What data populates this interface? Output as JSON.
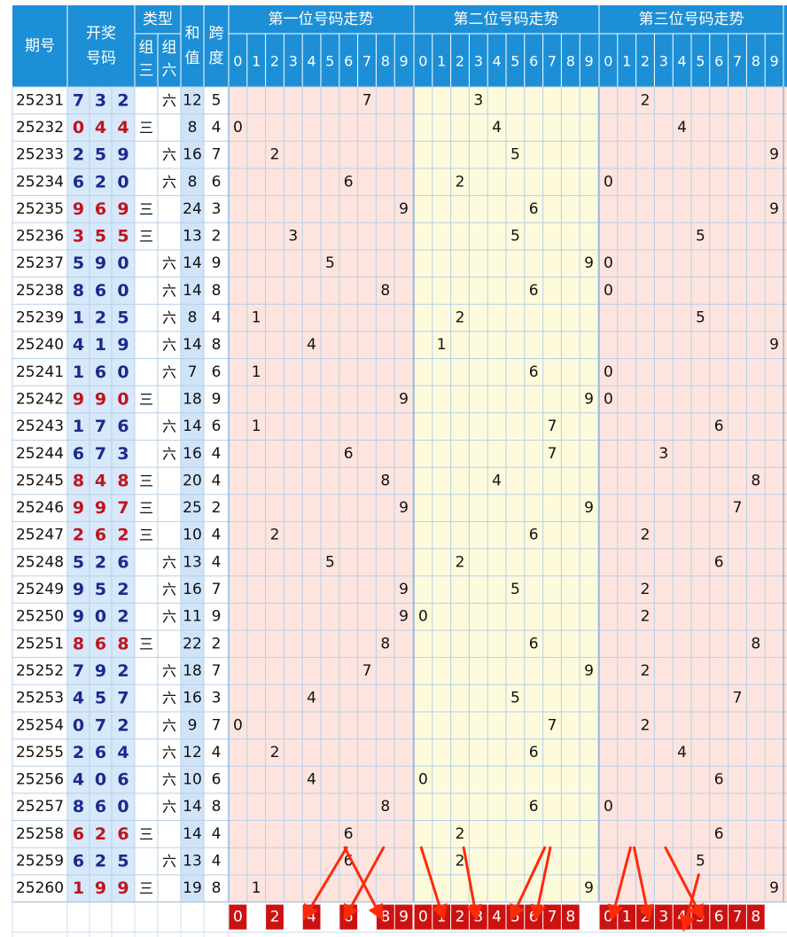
{
  "header": {
    "period_label": "期号",
    "draw_label_line1": "开奖",
    "draw_label_line2": "号码",
    "type_label": "类型",
    "type_sub_a_line1": "组",
    "type_sub_a_line2": "三",
    "type_sub_b_line1": "组",
    "type_sub_b_line2": "六",
    "sum_label_line1": "和",
    "sum_label_line2": "值",
    "span_label_line1": "跨",
    "span_label_line2": "度",
    "sections": [
      "第一位号码走势",
      "第二位号码走势",
      "第三位号码走势"
    ],
    "digits": [
      "0",
      "1",
      "2",
      "3",
      "4",
      "5",
      "6",
      "7",
      "8",
      "9"
    ]
  },
  "colors": {
    "header_bg": "#1c8fd6",
    "header_text": "#ffffff",
    "pink_zone": "#fde4df",
    "yellow_zone": "#fdfbdc",
    "draw_bg": "#d7e8fb",
    "sum_bg": "#cfe4f9",
    "grid_line": "#b8cfe6",
    "digit_blue": "#1a2a8c",
    "digit_red": "#c0141c",
    "marker_red": "#cc1111",
    "arrow_red": "#ff2a0a"
  },
  "chart_data": {
    "type": "table",
    "rows": [
      {
        "period": "25231",
        "digits": [
          7,
          3,
          2
        ],
        "group3": "",
        "group6": "六",
        "sum": "12",
        "span": "5"
      },
      {
        "period": "25232",
        "digits": [
          0,
          4,
          4
        ],
        "group3": "三",
        "group6": "",
        "sum": "8",
        "span": "4"
      },
      {
        "period": "25233",
        "digits": [
          2,
          5,
          9
        ],
        "group3": "",
        "group6": "六",
        "sum": "16",
        "span": "7"
      },
      {
        "period": "25234",
        "digits": [
          6,
          2,
          0
        ],
        "group3": "",
        "group6": "六",
        "sum": "8",
        "span": "6"
      },
      {
        "period": "25235",
        "digits": [
          9,
          6,
          9
        ],
        "group3": "三",
        "group6": "",
        "sum": "24",
        "span": "3"
      },
      {
        "period": "25236",
        "digits": [
          3,
          5,
          5
        ],
        "group3": "三",
        "group6": "",
        "sum": "13",
        "span": "2"
      },
      {
        "period": "25237",
        "digits": [
          5,
          9,
          0
        ],
        "group3": "",
        "group6": "六",
        "sum": "14",
        "span": "9"
      },
      {
        "period": "25238",
        "digits": [
          8,
          6,
          0
        ],
        "group3": "",
        "group6": "六",
        "sum": "14",
        "span": "8"
      },
      {
        "period": "25239",
        "digits": [
          1,
          2,
          5
        ],
        "group3": "",
        "group6": "六",
        "sum": "8",
        "span": "4"
      },
      {
        "period": "25240",
        "digits": [
          4,
          1,
          9
        ],
        "group3": "",
        "group6": "六",
        "sum": "14",
        "span": "8"
      },
      {
        "period": "25241",
        "digits": [
          1,
          6,
          0
        ],
        "group3": "",
        "group6": "六",
        "sum": "7",
        "span": "6"
      },
      {
        "period": "25242",
        "digits": [
          9,
          9,
          0
        ],
        "group3": "三",
        "group6": "",
        "sum": "18",
        "span": "9"
      },
      {
        "period": "25243",
        "digits": [
          1,
          7,
          6
        ],
        "group3": "",
        "group6": "六",
        "sum": "14",
        "span": "6"
      },
      {
        "period": "25244",
        "digits": [
          6,
          7,
          3
        ],
        "group3": "",
        "group6": "六",
        "sum": "16",
        "span": "4"
      },
      {
        "period": "25245",
        "digits": [
          8,
          4,
          8
        ],
        "group3": "三",
        "group6": "",
        "sum": "20",
        "span": "4"
      },
      {
        "period": "25246",
        "digits": [
          9,
          9,
          7
        ],
        "group3": "三",
        "group6": "",
        "sum": "25",
        "span": "2"
      },
      {
        "period": "25247",
        "digits": [
          2,
          6,
          2
        ],
        "group3": "三",
        "group6": "",
        "sum": "10",
        "span": "4"
      },
      {
        "period": "25248",
        "digits": [
          5,
          2,
          6
        ],
        "group3": "",
        "group6": "六",
        "sum": "13",
        "span": "4"
      },
      {
        "period": "25249",
        "digits": [
          9,
          5,
          2
        ],
        "group3": "",
        "group6": "六",
        "sum": "16",
        "span": "7"
      },
      {
        "period": "25250",
        "digits": [
          9,
          0,
          2
        ],
        "group3": "",
        "group6": "六",
        "sum": "11",
        "span": "9"
      },
      {
        "period": "25251",
        "digits": [
          8,
          6,
          8
        ],
        "group3": "三",
        "group6": "",
        "sum": "22",
        "span": "2"
      },
      {
        "period": "25252",
        "digits": [
          7,
          9,
          2
        ],
        "group3": "",
        "group6": "六",
        "sum": "18",
        "span": "7"
      },
      {
        "period": "25253",
        "digits": [
          4,
          5,
          7
        ],
        "group3": "",
        "group6": "六",
        "sum": "16",
        "span": "3"
      },
      {
        "period": "25254",
        "digits": [
          0,
          7,
          2
        ],
        "group3": "",
        "group6": "六",
        "sum": "9",
        "span": "7"
      },
      {
        "period": "25255",
        "digits": [
          2,
          6,
          4
        ],
        "group3": "",
        "group6": "六",
        "sum": "12",
        "span": "4"
      },
      {
        "period": "25256",
        "digits": [
          4,
          0,
          6
        ],
        "group3": "",
        "group6": "六",
        "sum": "10",
        "span": "6"
      },
      {
        "period": "25257",
        "digits": [
          8,
          6,
          0
        ],
        "group3": "",
        "group6": "六",
        "sum": "14",
        "span": "8"
      },
      {
        "period": "25258",
        "digits": [
          6,
          2,
          6
        ],
        "group3": "三",
        "group6": "",
        "sum": "14",
        "span": "4"
      },
      {
        "period": "25259",
        "digits": [
          6,
          2,
          5
        ],
        "group3": "",
        "group6": "六",
        "sum": "13",
        "span": "4"
      },
      {
        "period": "25260",
        "digits": [
          1,
          9,
          9
        ],
        "group3": "三",
        "group6": "",
        "sum": "19",
        "span": "8"
      }
    ],
    "predicted_marks": [
      [
        "0",
        "",
        "2",
        "",
        "4",
        "",
        "6",
        "",
        "8",
        "9"
      ],
      [
        "0",
        "1",
        "2",
        "3",
        "4",
        "5",
        "6",
        "7",
        "8",
        ""
      ],
      [
        "0",
        "1",
        "2",
        "3",
        "4",
        "5",
        "6",
        "7",
        "8",
        ""
      ]
    ],
    "arrows": [
      {
        "from": [
          6.4,
          28
        ],
        "to": [
          4.1,
          30.6
        ]
      },
      {
        "from": [
          8.4,
          28
        ],
        "to": [
          6.3,
          30.6
        ]
      },
      {
        "from": [
          6.3,
          28
        ],
        "to": [
          8.3,
          30.6
        ]
      },
      {
        "from": [
          0.4,
          28
        ],
        "to": [
          1.6,
          30.6
        ]
      },
      {
        "from": [
          2.7,
          28
        ],
        "to": [
          3.4,
          30.6
        ]
      },
      {
        "from": [
          7.1,
          28
        ],
        "to": [
          5.3,
          30.6
        ]
      },
      {
        "from": [
          7.4,
          28
        ],
        "to": [
          6.6,
          30.6
        ]
      },
      {
        "from": [
          1.7,
          28
        ],
        "to": [
          0.7,
          30.6
        ]
      },
      {
        "from": [
          1.9,
          28
        ],
        "to": [
          2.7,
          30.6
        ]
      },
      {
        "from": [
          3.6,
          28
        ],
        "to": [
          5.6,
          30.6
        ]
      },
      {
        "from": [
          5.4,
          29
        ],
        "to": [
          4.6,
          31.0
        ]
      }
    ]
  }
}
